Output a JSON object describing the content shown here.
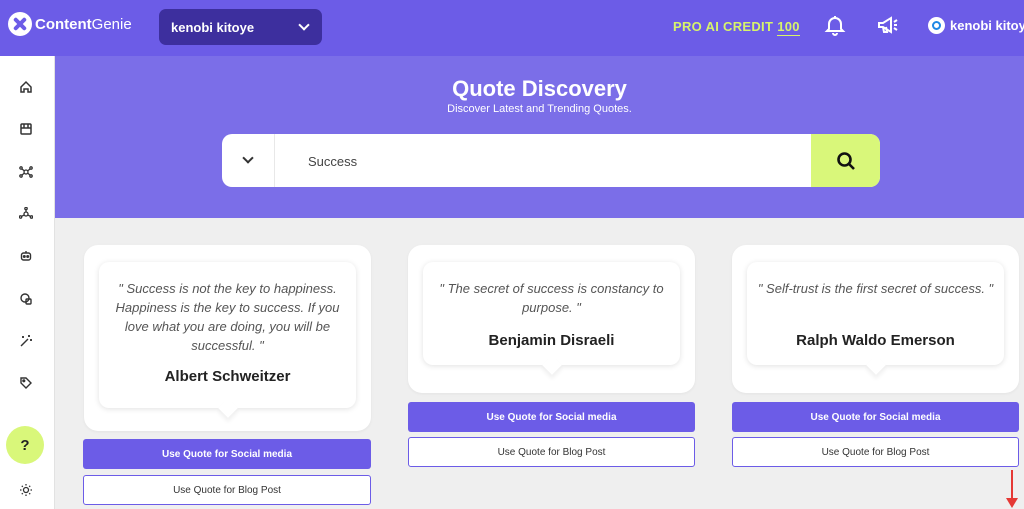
{
  "app": {
    "logo_bold": "Content",
    "logo_light": "Genie"
  },
  "header": {
    "workspace": "kenobi kitoye",
    "credit_label": "PRO AI CREDIT",
    "credit_value": "100",
    "user_name": "kenobi kitoye"
  },
  "sidebar": {
    "items": [
      "home-icon",
      "store-icon",
      "network-icon",
      "nodes-icon",
      "robot-icon",
      "shapes-icon",
      "magic-wand-icon",
      "tag-icon"
    ],
    "help_label": "?",
    "theme_icon": "sun-icon"
  },
  "hero": {
    "title": "Quote Discovery",
    "subtitle": "Discover Latest and Trending Quotes.",
    "search_value": "Success"
  },
  "quotes": [
    {
      "text": "\" Success is not the key to happiness. Happiness is the key to success. If you love what you are doing, you will be successful. \"",
      "author": "Albert Schweitzer",
      "social_label": "Use Quote for Social media",
      "blog_label": "Use Quote for Blog Post"
    },
    {
      "text": "\" The secret of success is constancy to purpose. \"",
      "author": "Benjamin Disraeli",
      "social_label": "Use Quote for Social media",
      "blog_label": "Use Quote for Blog Post"
    },
    {
      "text": "\" Self-trust is the first secret of success. \"",
      "author": "Ralph Waldo Emerson",
      "social_label": "Use Quote for Social media",
      "blog_label": "Use Quote for Blog Post"
    }
  ],
  "colors": {
    "brand": "#6c5ce7",
    "accent": "#d9f77a",
    "arrow": "#e53935"
  }
}
